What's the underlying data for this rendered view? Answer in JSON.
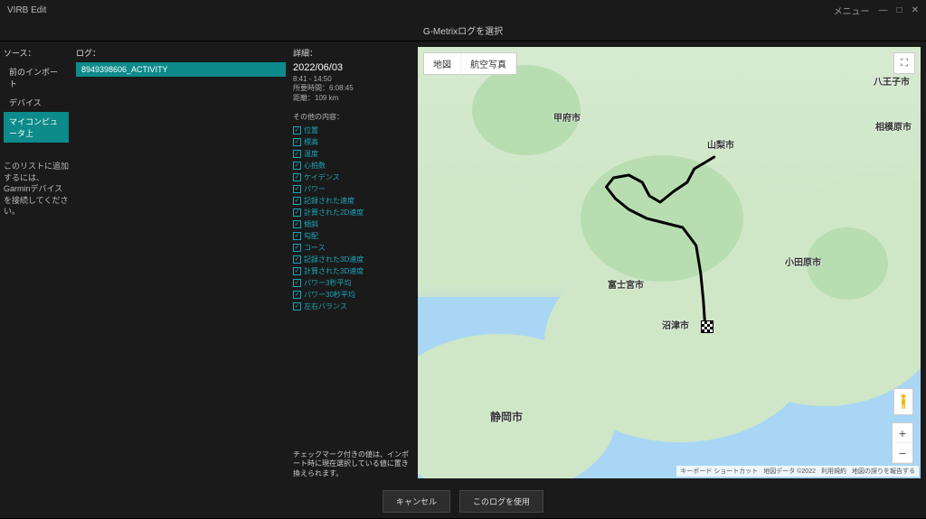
{
  "app": {
    "title": "VIRB Edit",
    "menu": "メニュー"
  },
  "header": {
    "dialog_title": "G-Metrixログを選択"
  },
  "sources": {
    "label": "ソース：",
    "items": [
      {
        "label": "前のインポート",
        "active": false
      },
      {
        "label": "デバイス",
        "active": false
      },
      {
        "label": "マイコンピュータ上",
        "active": true
      }
    ],
    "help": "このリストに追加するには、Garminデバイスを接続してください。"
  },
  "logs": {
    "label": "ログ：",
    "items": [
      {
        "name": "8949398606_ACTIVITY"
      }
    ]
  },
  "details": {
    "label": "詳細：",
    "date": "2022/06/03",
    "time_range": "8:41 - 14:50",
    "duration_label": "所要時間：",
    "duration_value": "6:08:45",
    "distance_label": "距離：",
    "distance_value": "109 km",
    "other_label": "その他の内容：",
    "checks": [
      "位置",
      "標高",
      "温度",
      "心拍数",
      "ケイデンス",
      "パワー",
      "記録された速度",
      "計算された2D速度",
      "傾斜",
      "勾配",
      "コース",
      "記録された3D速度",
      "計算された3D速度",
      "パワー3秒平均",
      "パワー30秒平均",
      "左右バランス"
    ],
    "note": "チェックマーク付きの値は、インポート時に現在選択している値に置き換えられます。"
  },
  "map": {
    "tab_map": "地図",
    "tab_sat": "航空写真",
    "labels": {
      "hachioji": "八王子市",
      "sagamihara": "相模原市",
      "yamanashi": "山梨市",
      "kofu": "甲府市",
      "fujinomiya": "富士宮市",
      "numazu": "沼津市",
      "shizuoka": "静岡市",
      "odawara": "小田原市"
    },
    "attrib": {
      "a": "キーボード ショートカット",
      "b": "地図データ ©2022",
      "c": "利用規約",
      "d": "地図の誤りを報告する"
    }
  },
  "footer": {
    "cancel": "キャンセル",
    "use_log": "このログを使用"
  }
}
